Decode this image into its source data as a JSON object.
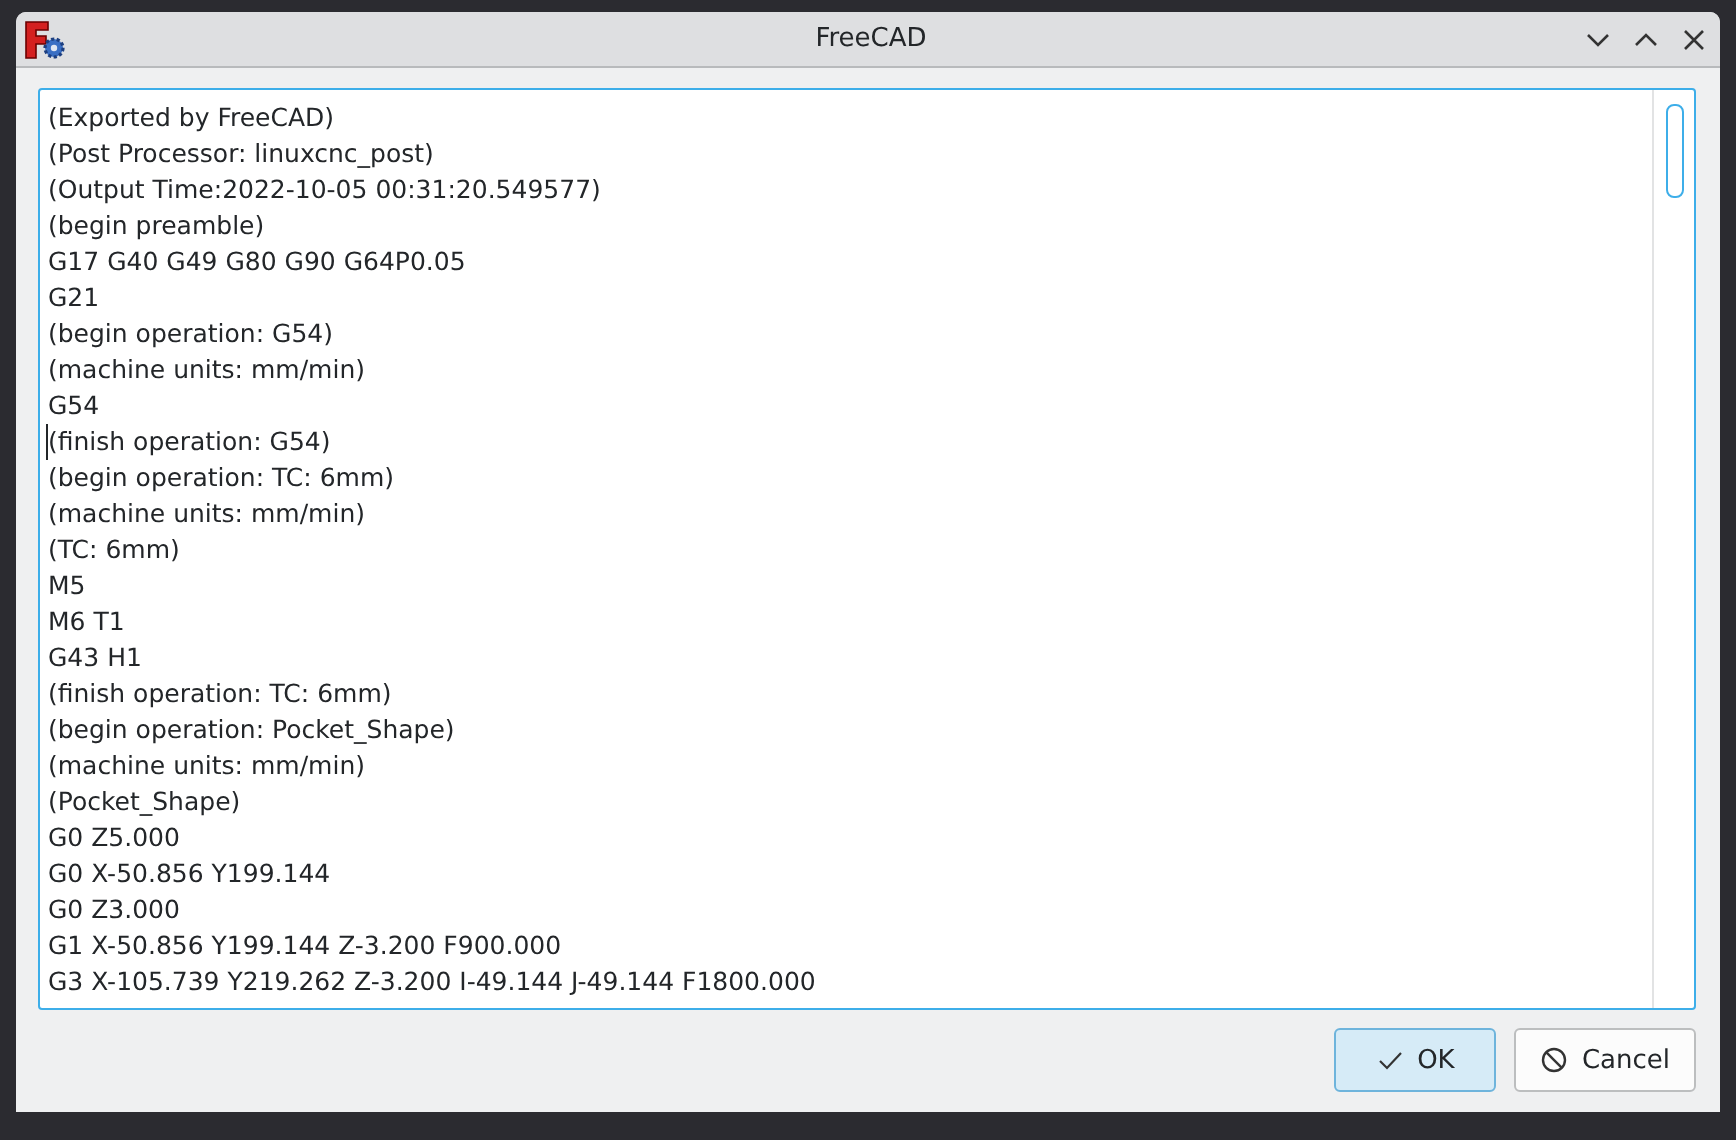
{
  "window": {
    "title": "FreeCAD"
  },
  "editor": {
    "lines": [
      "(Exported by FreeCAD)",
      "(Post Processor: linuxcnc_post)",
      "(Output Time:2022-10-05 00:31:20.549577)",
      "(begin preamble)",
      "G17 G40 G49 G80 G90 G64P0.05",
      "G21",
      "(begin operation: G54)",
      "(machine units: mm/min)",
      "G54",
      "(finish operation: G54)",
      "(begin operation: TC: 6mm)",
      "(machine units: mm/min)",
      "(TC: 6mm)",
      "M5",
      "M6 T1",
      "G43 H1",
      "(finish operation: TC: 6mm)",
      "(begin operation: Pocket_Shape)",
      "(machine units: mm/min)",
      "(Pocket_Shape)",
      "G0 Z5.000",
      "G0 X-50.856 Y199.144",
      "G0 Z3.000",
      "G1 X-50.856 Y199.144 Z-3.200 F900.000",
      "G3 X-105.739 Y219.262 Z-3.200 I-49.144 J-49.144 F1800.000"
    ]
  },
  "buttons": [
    {
      "label": "OK",
      "kind": "ok",
      "default": true
    },
    {
      "label": "Cancel",
      "kind": "cancel",
      "default": false
    }
  ]
}
